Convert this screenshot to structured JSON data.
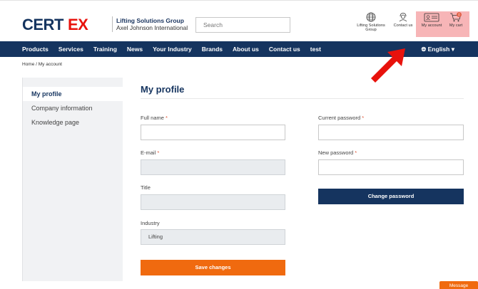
{
  "brand": {
    "logo_text": "CERTEX",
    "tagline_1": "Lifting Solutions Group",
    "tagline_2": "Axel Johnson International"
  },
  "search": {
    "placeholder": "Search"
  },
  "header_icons": {
    "lifting_solutions": "Lifting Solutions Group",
    "contact": "Contact us",
    "my_account": "My account",
    "my_cart": "My cart",
    "cart_count": "0"
  },
  "nav": {
    "items": [
      "Products",
      "Services",
      "Training",
      "News",
      "Your Industry",
      "Brands",
      "About us",
      "Contact us",
      "test"
    ],
    "language": "English"
  },
  "breadcrumb": "Home / My account",
  "sidebar": {
    "items": [
      "My profile",
      "Company information",
      "Knowledge page"
    ]
  },
  "page": {
    "title": "My profile",
    "full_name_label": "Full name",
    "email_label": "E-mail",
    "title_label": "Title",
    "industry_label": "Industry",
    "industry_value": "Lifting",
    "current_password_label": "Current password",
    "new_password_label": "New password",
    "required_mark": "*",
    "save_button": "Save changes",
    "change_password_button": "Change password"
  },
  "message_tab": "Message",
  "colors": {
    "navy": "#15345f",
    "orange": "#f06a0f",
    "highlight": "#f7b5b7",
    "arrow_red": "#e8120c"
  }
}
